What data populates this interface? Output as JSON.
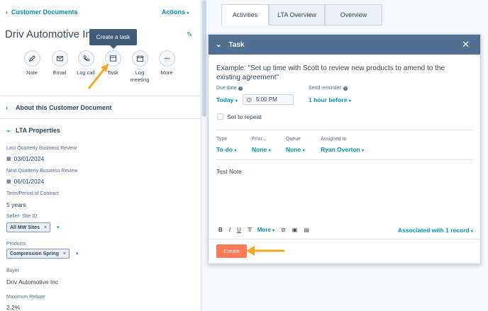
{
  "sidebar": {
    "back_label": "Customer Documents",
    "actions_label": "Actions",
    "record_name": "Driv Automotive Inc",
    "tooltip": "Create a task",
    "quick_actions": [
      {
        "label": "Note",
        "icon": "note-icon"
      },
      {
        "label": "Email",
        "icon": "email-icon"
      },
      {
        "label": "Log call",
        "icon": "phone-icon"
      },
      {
        "label": "Task",
        "icon": "task-icon"
      },
      {
        "label": "Log\nmeeting",
        "icon": "calendar-icon"
      },
      {
        "label": "More",
        "icon": "more-icon"
      }
    ],
    "sections": {
      "about": "About this Customer Document",
      "lta": "LTA Properties"
    },
    "properties": {
      "last_qbr_label": "Last Quarterly Business Review",
      "last_qbr_value": "03/01/2024",
      "next_qbr_label": "Next Quarterly Business Review",
      "next_qbr_value": "06/01/2024",
      "term_label": "Term/Period of Contract",
      "term_value": "5 years",
      "seller_label": "Seller- Site ID",
      "seller_tag": "All MW Sites",
      "products_label": "Products",
      "products_tag": "Compression Spring",
      "buyer_label": "Buyer",
      "buyer_value": "Driv Automotive Inc",
      "rebate_label": "Maximum Rebate",
      "rebate_value": "2.2%"
    }
  },
  "tabs": [
    "Activities",
    "LTA Overview",
    "Overview"
  ],
  "task_modal": {
    "header": "Task",
    "title": "Example: \"Set up time with Scott to review new products to amend to the existing agreement\"",
    "due_date_label": "Due date",
    "due_date_value": "Today",
    "due_time_value": "5:00 PM",
    "reminder_label": "Send reminder",
    "reminder_value": "1 hour before",
    "repeat_label": "Set to repeat",
    "type_label": "Type",
    "type_value": "To-do",
    "priority_label": "Prior...",
    "priority_value": "None",
    "queue_label": "Queue",
    "queue_value": "None",
    "assigned_label": "Assigned to",
    "assigned_value": "Ryan Overton",
    "notes": "Test Note",
    "toolbar_more": "More",
    "associated": "Associated with 1 record",
    "create_label": "Create"
  },
  "colors": {
    "accent": "#0091ae",
    "header": "#516f90",
    "primary_button": "#ff7a59",
    "annotation_arrow": "#f5a623"
  }
}
